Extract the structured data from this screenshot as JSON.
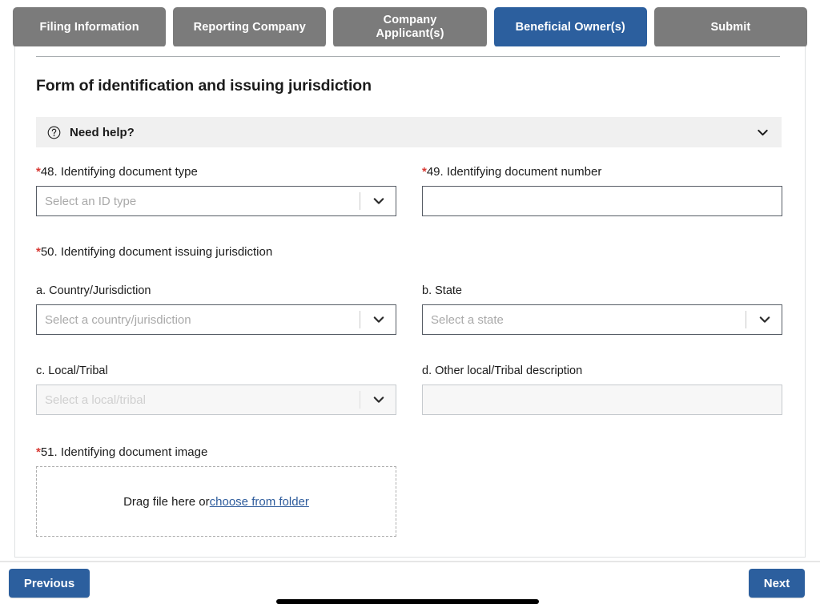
{
  "tabs": [
    {
      "label": "Filing Information",
      "active": false
    },
    {
      "label": "Reporting Company",
      "active": false
    },
    {
      "label": "Company\nApplicant(s)",
      "active": false
    },
    {
      "label": "Beneficial Owner(s)",
      "active": true
    },
    {
      "label": "Submit",
      "active": false
    }
  ],
  "section": {
    "title": "Form of identification and issuing jurisdiction"
  },
  "help": {
    "label": "Need help?",
    "icon": "question-circle-icon",
    "chevron": "chevron-down-icon"
  },
  "fields": {
    "doc_type": {
      "required_marker": "*",
      "label": "48. Identifying document type",
      "placeholder": "Select an ID type",
      "value": "",
      "disabled": false
    },
    "doc_number": {
      "required_marker": "*",
      "label": "49. Identifying document number",
      "placeholder": "",
      "value": "",
      "disabled": false
    },
    "jurisdiction_group": {
      "required_marker": "*",
      "label": "50. Identifying document issuing jurisdiction"
    },
    "country": {
      "label": "a. Country/Jurisdiction",
      "placeholder": "Select a country/jurisdiction",
      "value": "",
      "disabled": false
    },
    "state": {
      "label": "b. State",
      "placeholder": "Select a state",
      "value": "",
      "disabled": false
    },
    "local_tribal": {
      "label": "c. Local/Tribal",
      "placeholder": "Select a local/tribal",
      "value": "",
      "disabled": true
    },
    "other_local_tribal": {
      "label": "d. Other local/Tribal description",
      "placeholder": "",
      "value": "",
      "disabled": true
    },
    "doc_image": {
      "required_marker": "*",
      "label": "51. Identifying document image",
      "drop_text": "Drag file here or ",
      "drop_link": "choose from folder"
    }
  },
  "footer": {
    "previous_label": "Previous",
    "next_label": "Next"
  },
  "colors": {
    "accent_blue": "#2c5f9e",
    "tab_inactive": "#7b7b7b",
    "required_red": "#d83933",
    "link_blue": "#2e5c9c",
    "help_bar_bg": "#f0f0f0",
    "disabled_bg": "#f7f7f7"
  }
}
